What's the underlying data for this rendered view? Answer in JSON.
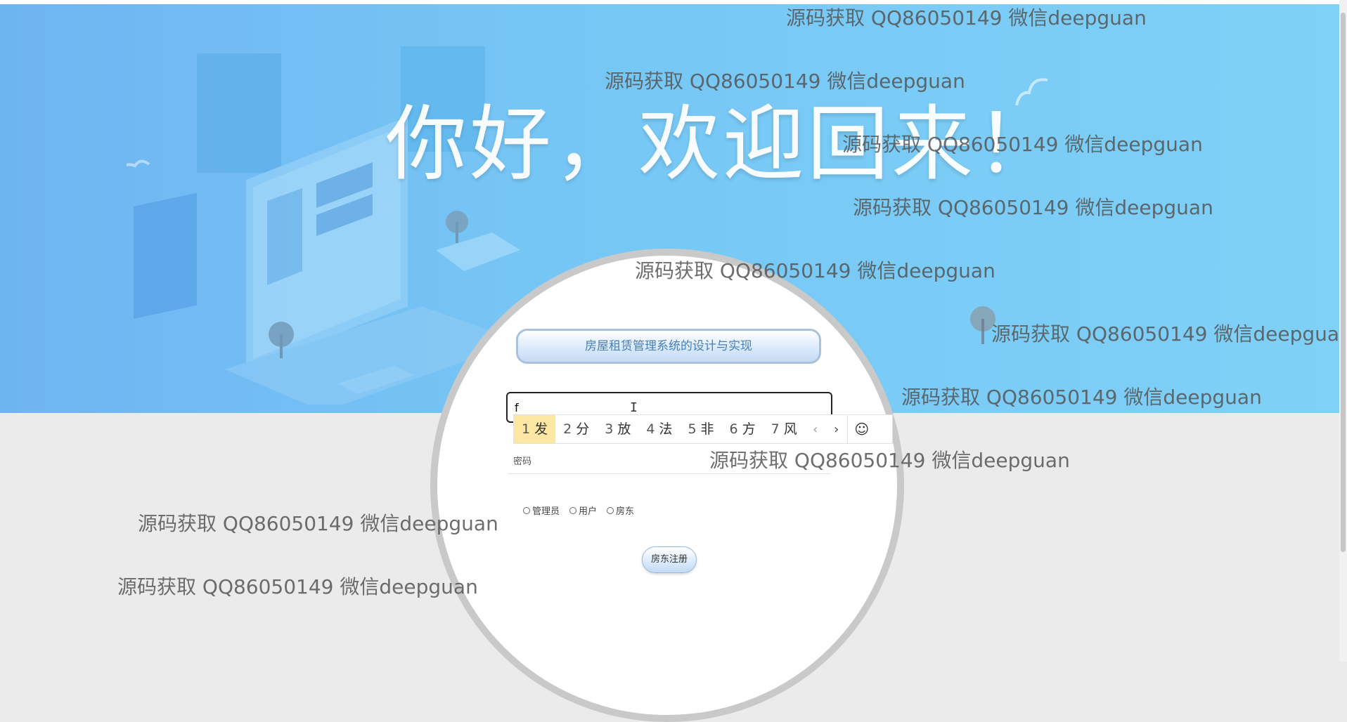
{
  "hero": {
    "greeting": "你好，欢迎回来！"
  },
  "login": {
    "system_title": "房屋租赁管理系统的设计与实现",
    "username_value": "f",
    "password_placeholder": "密码",
    "roles": [
      "管理员",
      "用户",
      "房东"
    ],
    "register_button": "房东注册"
  },
  "ime": {
    "candidates": [
      {
        "num": "1",
        "char": "发"
      },
      {
        "num": "2",
        "char": "分"
      },
      {
        "num": "3",
        "char": "放"
      },
      {
        "num": "4",
        "char": "法"
      },
      {
        "num": "5",
        "char": "非"
      },
      {
        "num": "6",
        "char": "方"
      },
      {
        "num": "7",
        "char": "风"
      }
    ],
    "prev": "‹",
    "next": "›",
    "emoji": "☺"
  },
  "watermark": {
    "text": "源码获取 QQ86050149 微信deepguan",
    "text_cut": "源码获取 QQ86050149 微信deepgua"
  },
  "colors": {
    "hero": "#76c6f5",
    "ime_active": "#fde7a2",
    "title_text": "#4a7fb6"
  }
}
